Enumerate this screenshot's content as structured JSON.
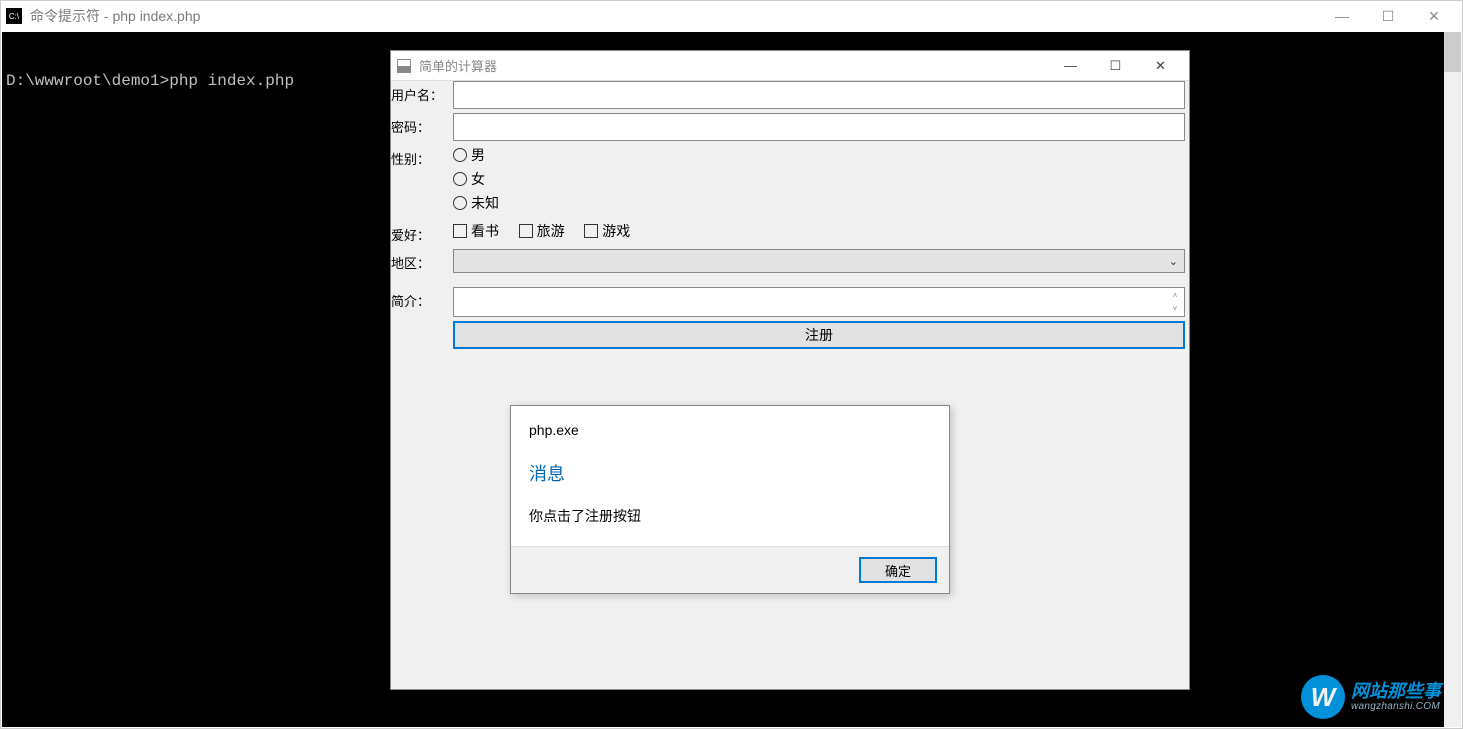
{
  "outer": {
    "title": "命令提示符 - php  index.php",
    "icon_text": "C:\\",
    "prompt": "D:\\wwwroot\\demo1>php index.php"
  },
  "innerWin": {
    "title": "简单的计算器"
  },
  "form": {
    "username_label": "用户名：",
    "password_label": "密码：",
    "gender_label": "性别：",
    "gender_options": {
      "male": "男",
      "female": "女",
      "unknown": "未知"
    },
    "hobby_label": "爱好：",
    "hobby_options": {
      "read": "看书",
      "travel": "旅游",
      "game": "游戏"
    },
    "region_label": "地区：",
    "intro_label": "简介：",
    "register_btn": "注册"
  },
  "dialog": {
    "app": "php.exe",
    "heading": "消息",
    "message": "你点击了注册按钮",
    "ok": "确定"
  },
  "watermark": {
    "letter": "W",
    "cn": "网站那些事",
    "en": "wangzhanshi.COM"
  }
}
